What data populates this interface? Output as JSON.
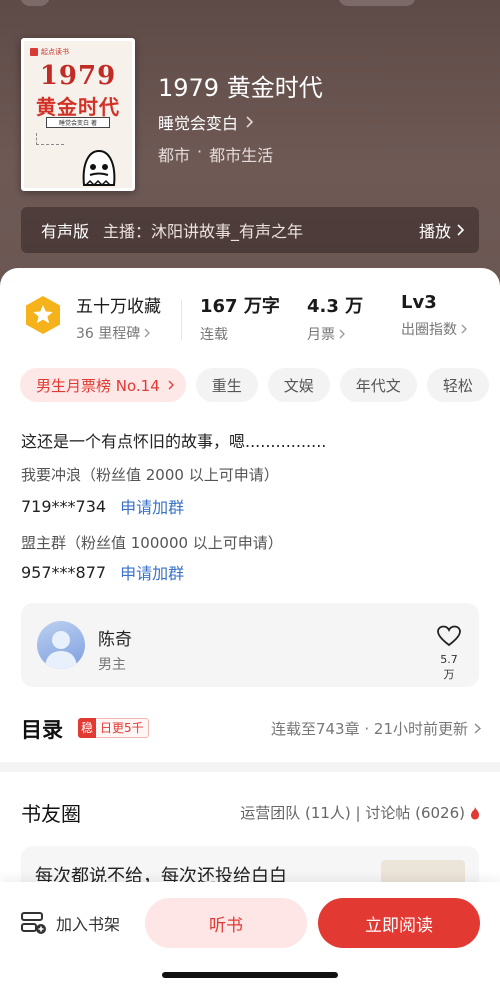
{
  "book": {
    "title": "1979 黄金时代",
    "author": "睡觉会变白",
    "genre_main": "都市",
    "genre_dot": "·",
    "genre_sub": "都市生活",
    "cover": {
      "publisher": "起点读书",
      "year": "1979",
      "title": "黄金时代",
      "author_tag": "睡觉会变白 著"
    }
  },
  "audio": {
    "tag": "有声版",
    "anchor": "主播：沐阳讲故事_有声之年",
    "play": "播放"
  },
  "stats": {
    "favorites_value": "五十万收藏",
    "favorites_label": "36 里程碑",
    "words_value": "167 万字",
    "words_label": "连载",
    "tickets_value": "4.3 万",
    "tickets_label": "月票",
    "level_value": "Lv3",
    "level_label": "出圈指数"
  },
  "tags": {
    "rank": "男生月票榜 No.14",
    "items": [
      "重生",
      "文娱",
      "年代文",
      "轻松"
    ]
  },
  "description": "这还是一个有点怀旧的故事，嗯................",
  "groups": [
    {
      "title": "我要冲浪（粉丝值 2000 以上可申请）",
      "number": "719***734",
      "action": "申请加群"
    },
    {
      "title": "盟主群（粉丝值 100000 以上可申请）",
      "number": "957***877",
      "action": "申请加群"
    }
  ],
  "character": {
    "name": "陈奇",
    "role": "男主",
    "likes": "5.7万"
  },
  "toc": {
    "title": "目录",
    "badge_icon": "稳",
    "badge_text": "日更5千",
    "status": "连载至743章 · 21小时前更新"
  },
  "circle": {
    "title": "书友圈",
    "meta": "运营团队 (11人) | 讨论帖 (6026)",
    "post_preview": "每次都说不给，每次还投给白白"
  },
  "bottom": {
    "shelf": "加入书架",
    "listen": "听书",
    "read": "立即阅读"
  },
  "colors": {
    "accent": "#e23a33",
    "link": "#3a72c8",
    "hero_bg": "#6a5652"
  }
}
